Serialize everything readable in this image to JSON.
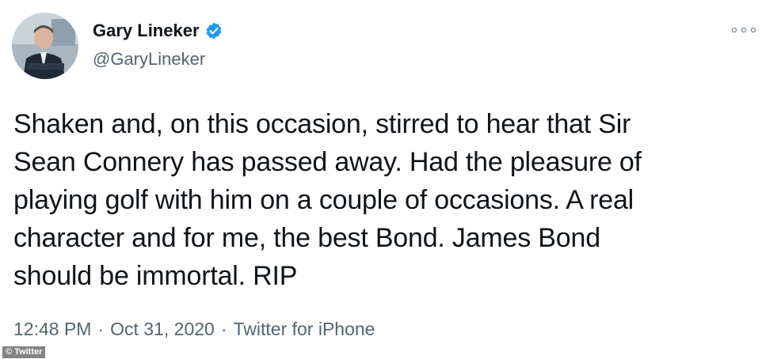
{
  "tweet": {
    "display_name": "Gary Lineker",
    "handle": "@GaryLineker",
    "verified_icon": "verified-badge-icon",
    "more_icon": "more-options-icon",
    "text_lines": [
      "Shaken and, on this occasion, stirred to hear that Sir",
      "Sean Connery has passed away. Had the pleasure of",
      "playing golf with him on a couple of occasions. A real",
      "character and for me, the best Bond. James Bond",
      "should be immortal. RIP"
    ],
    "time": "12:48 PM",
    "date": "Oct 31, 2020",
    "source": "Twitter for iPhone",
    "separator": "·"
  },
  "credit": "© Twitter",
  "colors": {
    "text": "#0f1419",
    "secondary": "#536471",
    "verified": "#1d9bf0"
  }
}
